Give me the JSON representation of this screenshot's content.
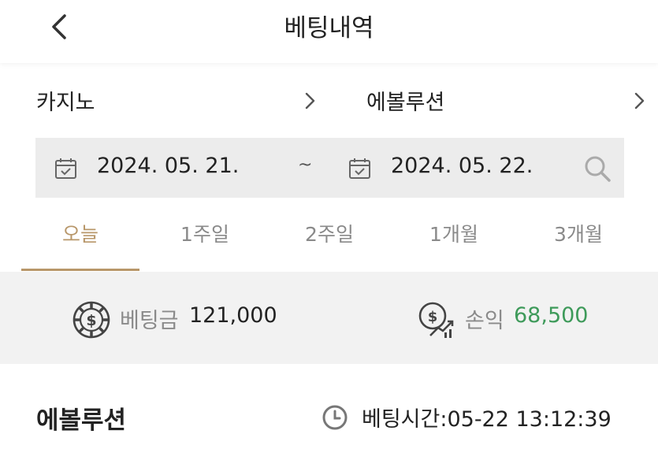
{
  "header": {
    "title": "베팅내역",
    "back_icon": "chevron-left-icon"
  },
  "filters": {
    "game_type": "카지노",
    "provider": "에볼루션",
    "date_from": "2024. 05. 21.",
    "separator": "~",
    "date_to": "2024. 05. 22."
  },
  "tabs": [
    {
      "label": "오늘",
      "active": true
    },
    {
      "label": "1주일"
    },
    {
      "label": "2주일"
    },
    {
      "label": "1개월"
    },
    {
      "label": "3개월"
    }
  ],
  "summary": {
    "bet_label": "베팅금",
    "bet_value": "121,000",
    "profit_label": "손익",
    "profit_value": "68,500",
    "profit_color": "#3e9a5a"
  },
  "record": {
    "provider": "에볼루션",
    "bet_time": "베팅시간:05-22 13:12:39"
  },
  "colors": {
    "accent": "#b8976a",
    "summary_bg": "#f2f2f2",
    "datebar_bg": "#ececec"
  }
}
